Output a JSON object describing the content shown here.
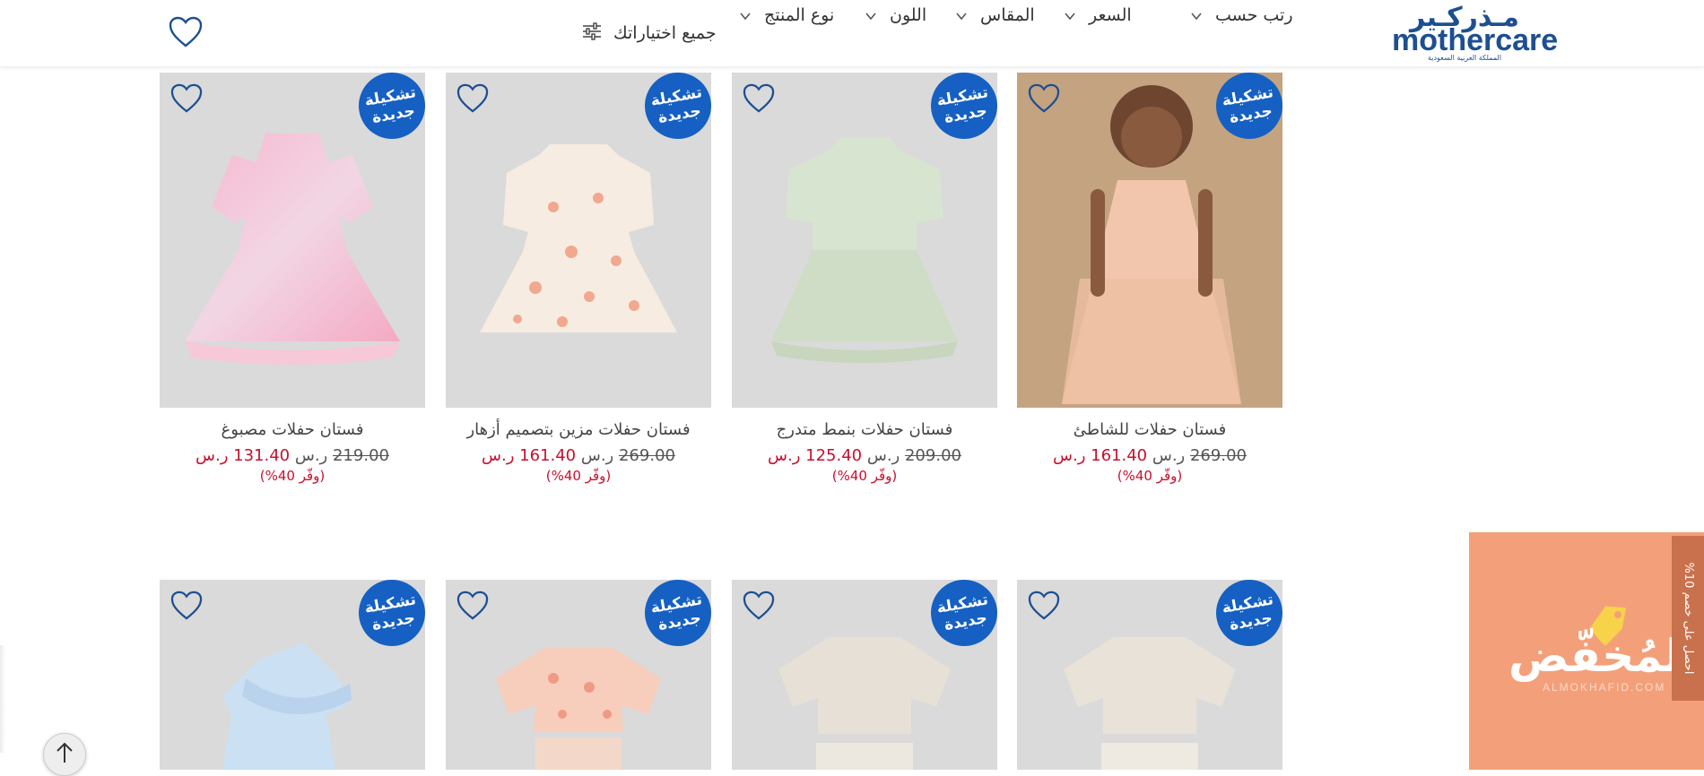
{
  "header": {
    "logo_arabic": "مـذركـير",
    "logo_english": "mothercare",
    "logo_sub": "المملكة العربية السعودية",
    "filters": [
      {
        "label": "رتب حسب"
      },
      {
        "label": "السعر"
      },
      {
        "label": "المقاس"
      },
      {
        "label": "اللون"
      },
      {
        "label": "نوع المنتج"
      }
    ],
    "all_filters_label": "جميع اختياراتك"
  },
  "badge": {
    "line1": "تشكيلة",
    "line2": "جديدة"
  },
  "currency": "ر.س",
  "old_currency": "ر.س",
  "products_row1": [
    {
      "name": "فستان حفلات مصبوغ",
      "old_price": "219.00",
      "price": "131.40",
      "save": "(وفّر 40%)"
    },
    {
      "name": "فستان حفلات مزين بتصميم أزهار",
      "old_price": "269.00",
      "price": "161.40",
      "save": "(وفّر 40%)"
    },
    {
      "name": "فستان حفلات بنمط متدرج",
      "old_price": "209.00",
      "price": "125.40",
      "save": "(وفّر 40%)"
    },
    {
      "name": "فستان حفلات للشاطئ",
      "old_price": "269.00",
      "price": "161.40",
      "save": "(وفّر 40%)"
    }
  ],
  "promo": {
    "word": "المُخفّض",
    "domain": "ALMOKHAFID.COM",
    "tab_text": "احصل على خصم 10%"
  },
  "colors": {
    "brand_blue": "#1d4f91",
    "badge_blue": "#1560c2",
    "sale_red": "#c8102e",
    "promo_orange": "#f3a07a"
  }
}
